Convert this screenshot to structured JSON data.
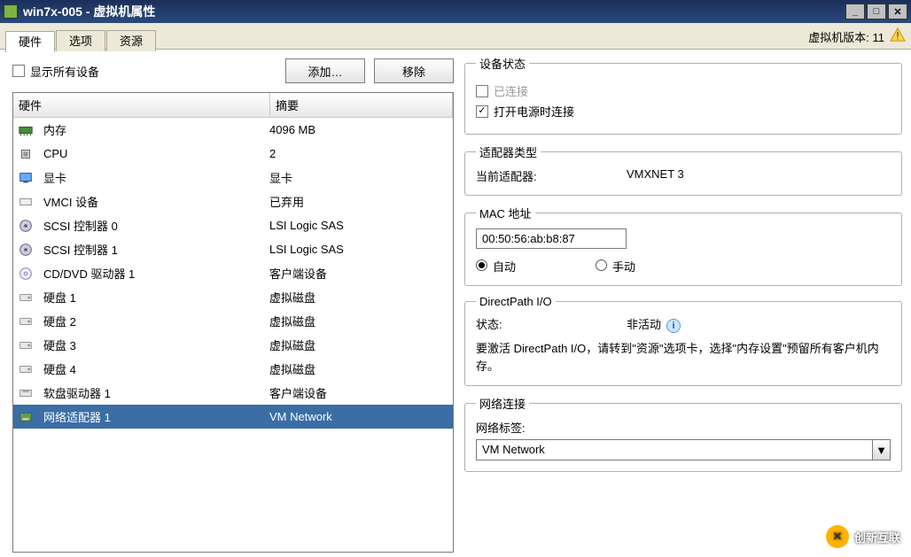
{
  "window": {
    "title": "win7x-005 - 虚拟机属性",
    "version_label": "虚拟机版本: 11"
  },
  "tabs": [
    {
      "label": "硬件",
      "active": true
    },
    {
      "label": "选项",
      "active": false
    },
    {
      "label": "资源",
      "active": false
    }
  ],
  "left": {
    "show_all_label": "显示所有设备",
    "show_all_checked": false,
    "add_btn": "添加…",
    "remove_btn": "移除",
    "headers": {
      "name": "硬件",
      "summary": "摘要"
    },
    "rows": [
      {
        "icon": "memory-icon",
        "label": "内存",
        "summary": "4096 MB"
      },
      {
        "icon": "cpu-icon",
        "label": "CPU",
        "summary": "2"
      },
      {
        "icon": "video-icon",
        "label": "显卡",
        "summary": "显卡"
      },
      {
        "icon": "vmci-icon",
        "label": "VMCI 设备",
        "summary": "已弃用"
      },
      {
        "icon": "scsi-icon",
        "label": "SCSI 控制器 0",
        "summary": "LSI Logic SAS"
      },
      {
        "icon": "scsi-icon",
        "label": "SCSI 控制器 1",
        "summary": "LSI Logic SAS"
      },
      {
        "icon": "cd-icon",
        "label": "CD/DVD 驱动器 1",
        "summary": "客户端设备"
      },
      {
        "icon": "disk-icon",
        "label": "硬盘 1",
        "summary": "虚拟磁盘"
      },
      {
        "icon": "disk-icon",
        "label": "硬盘 2",
        "summary": "虚拟磁盘"
      },
      {
        "icon": "disk-icon",
        "label": "硬盘 3",
        "summary": "虚拟磁盘"
      },
      {
        "icon": "disk-icon",
        "label": "硬盘 4",
        "summary": "虚拟磁盘"
      },
      {
        "icon": "floppy-icon",
        "label": "软盘驱动器 1",
        "summary": "客户端设备"
      },
      {
        "icon": "nic-icon",
        "label": "网络适配器 1",
        "summary": "VM Network",
        "selected": true
      }
    ]
  },
  "right": {
    "device_status": {
      "legend": "设备状态",
      "connected_label": "已连接",
      "connected_checked": false,
      "connected_disabled": true,
      "power_on_label": "打开电源时连接",
      "power_on_checked": true
    },
    "adapter_type": {
      "legend": "适配器类型",
      "key": "当前适配器:",
      "value": "VMXNET 3"
    },
    "mac": {
      "legend": "MAC 地址",
      "value": "00:50:56:ab:b8:87",
      "auto_label": "自动",
      "manual_label": "手动",
      "mode": "auto"
    },
    "directpath": {
      "legend": "DirectPath I/O",
      "status_key": "状态:",
      "status_value": "非活动",
      "hint": "要激活 DirectPath I/O，请转到\"资源\"选项卡，选择\"内存设置\"预留所有客户机内存。"
    },
    "network": {
      "legend": "网络连接",
      "label_key": "网络标签:",
      "value": "VM Network"
    }
  },
  "watermark": {
    "brand": "创新互联"
  }
}
